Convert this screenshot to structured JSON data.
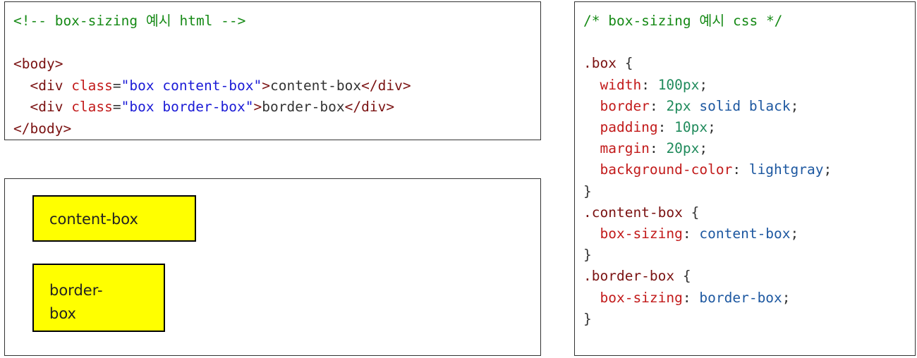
{
  "html_code": {
    "comment": "<!-- box-sizing 예시 html -->",
    "body_open": "<body>",
    "div1": {
      "indent": "  ",
      "open": "<div ",
      "attr": "class",
      "eq": "=",
      "value": "\"box content-box\"",
      "gt": ">",
      "text": "content-box",
      "close": "</div>"
    },
    "div2": {
      "indent": "  ",
      "open": "<div ",
      "attr": "class",
      "eq": "=",
      "value": "\"box border-box\"",
      "gt": ">",
      "text": "border-box",
      "close": "</div>"
    },
    "body_close": "</body>"
  },
  "preview": {
    "content_box_text": "content-box",
    "border_box_line1": "border-",
    "border_box_line2": "box",
    "box_color": "#ffff00"
  },
  "css_code": {
    "comment": "/* box-sizing 예시 css */",
    "box_rule": {
      "selector": ".box",
      "width": {
        "prop": "width",
        "value": "100px"
      },
      "border": {
        "prop": "border",
        "num": "2px",
        "rest": "solid black"
      },
      "padding": {
        "prop": "padding",
        "value": "10px"
      },
      "margin": {
        "prop": "margin",
        "value": "20px"
      },
      "background": {
        "prop": "background-color",
        "value": "lightgray"
      }
    },
    "content_rule": {
      "selector": ".content-box",
      "prop": "box-sizing",
      "value": "content-box"
    },
    "border_rule": {
      "selector": ".border-box",
      "prop": "box-sizing",
      "value": "border-box"
    },
    "open_brace": "{",
    "close_brace": "}",
    "colon": ":",
    "semicolon": ";"
  }
}
